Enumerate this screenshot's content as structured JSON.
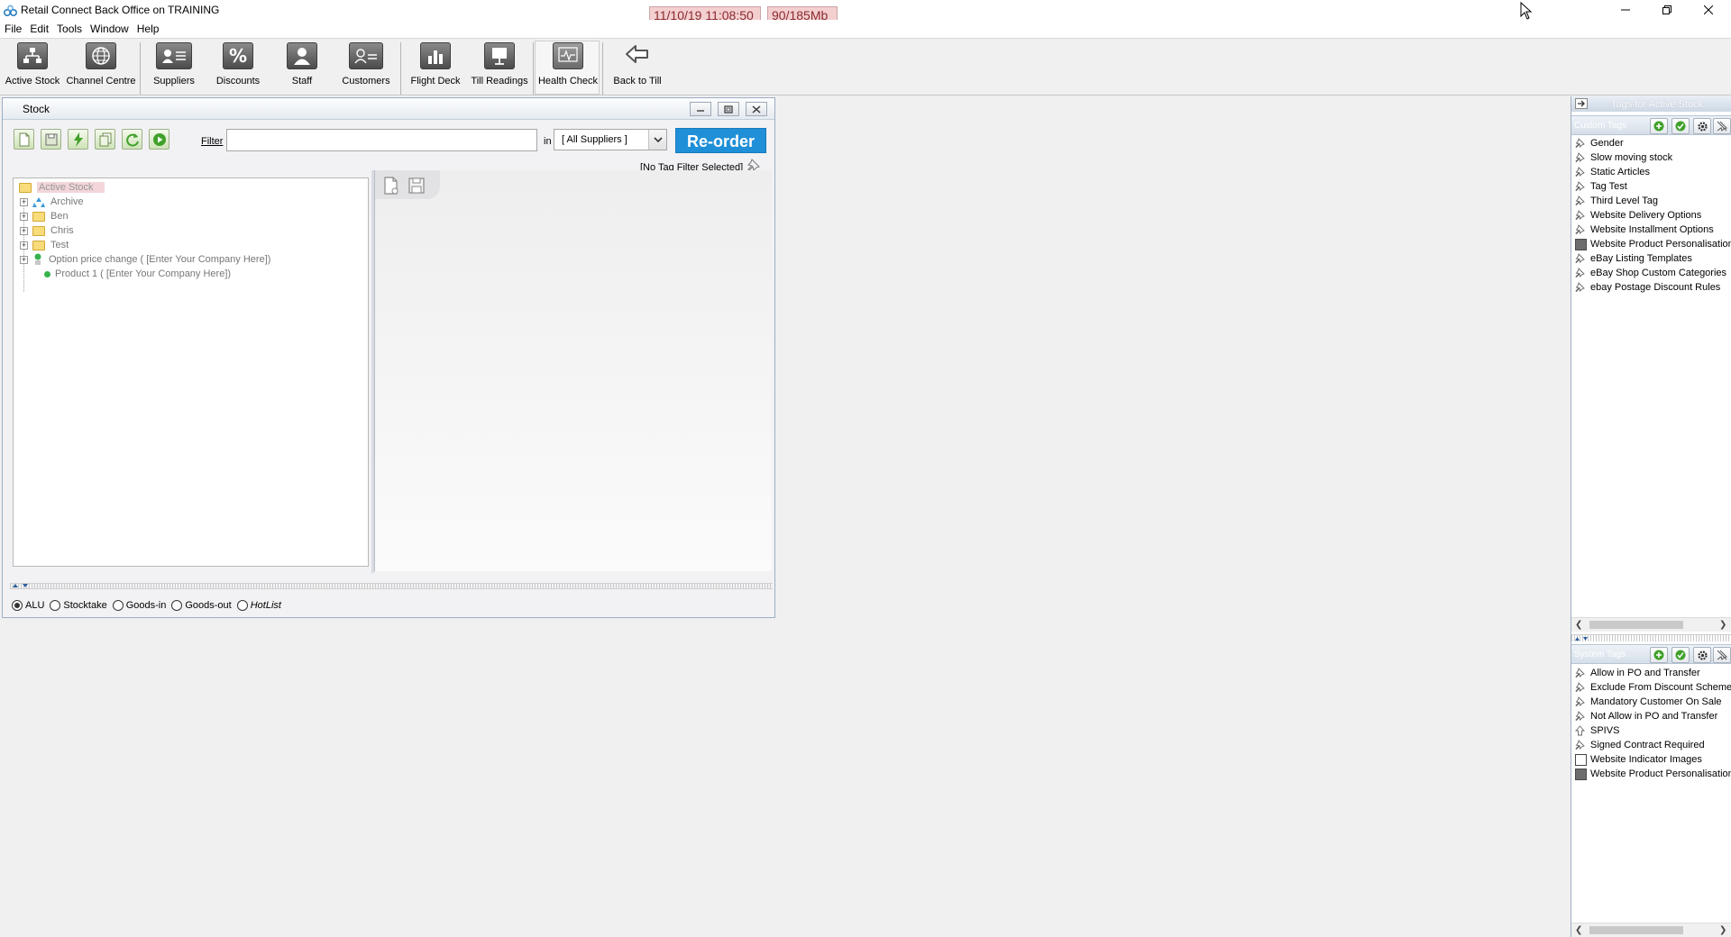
{
  "window": {
    "title": "Retail Connect Back Office on TRAINING",
    "clock": "11/10/19 11:08:50",
    "memory": "90/185Mb"
  },
  "menu": [
    "File",
    "Edit",
    "Tools",
    "Window",
    "Help"
  ],
  "toolbar": {
    "active_stock": "Active Stock",
    "channel_centre": "Channel Centre",
    "suppliers": "Suppliers",
    "discounts": "Discounts",
    "staff": "Staff",
    "customers": "Customers",
    "flight_deck": "Flight Deck",
    "till_readings": "Till Readings",
    "health_check": "Health Check",
    "back_to_till": "Back to Till"
  },
  "stock": {
    "title": "Stock",
    "filter_label": "Filter",
    "filter_value": "",
    "in_label": "in",
    "supplier_selected": "[ All Suppliers ]",
    "reorder_label": "Re-order",
    "tag_filter": "[No Tag Filter Selected]",
    "tree": {
      "root": "Active Stock",
      "items": [
        "Archive",
        "Ben",
        "Chris",
        "Test",
        "Option price change ( [Enter Your Company Here])",
        "Product 1 ( [Enter Your Company Here])"
      ]
    },
    "modes": [
      "ALU",
      "Stocktake",
      "Goods-in",
      "Goods-out",
      "HotList"
    ]
  },
  "tags": {
    "panel_title": "Tags for Active Stock",
    "custom_title": "Custom Tags",
    "custom": [
      "Gender",
      "Slow moving stock",
      "Static Articles",
      "Tag Test",
      "Third Level Tag",
      "Website Delivery Options",
      "Website Installment Options",
      "Website Product Personalisation",
      "eBay Listing Templates",
      "eBay Shop Custom Categories",
      "ebay Postage Discount Rules"
    ],
    "system_title": "System Tags",
    "system": [
      "Allow in PO and Transfer",
      "Exclude From Discount Scheme",
      "Mandatory Customer On Sale",
      "Not Allow in PO and Transfer",
      "SPIVS",
      "Signed Contract Required",
      "Website Indicator Images",
      "Website Product Personalisation"
    ]
  },
  "colors": {
    "accent": "#1f8fd8",
    "status_bg": "#f3cfd0",
    "status_fg": "#8b2a2e"
  }
}
